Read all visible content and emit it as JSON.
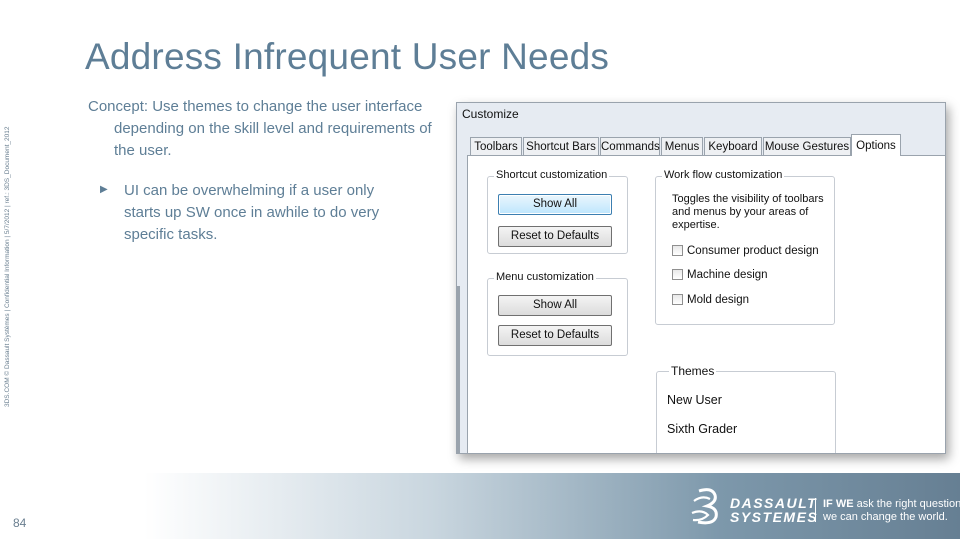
{
  "slide": {
    "title": "Address Infrequent User Needs",
    "side_text": "3DS.COM © Dassault Systèmes | Confidential Information | 5/7/2012 | ref.: 3DS_Document_2012",
    "page_number": "84",
    "concept_lines": [
      "Concept:  Use themes to change the user interface",
      "depending on the skill level and requirements of",
      "the user."
    ],
    "bullet_marker": "▶",
    "bullet_lines": [
      "UI can be overwhelming if a user only",
      "starts up SW once in awhile to do very",
      "specific tasks."
    ]
  },
  "dialog": {
    "title": "Customize",
    "tabs": [
      "Toolbars",
      "Shortcut Bars",
      "Commands",
      "Menus",
      "Keyboard",
      "Mouse Gestures",
      "Options"
    ],
    "active_tab": "Options",
    "shortcut_group": {
      "legend": "Shortcut customization",
      "show_all": "Show All",
      "reset": "Reset to Defaults"
    },
    "menu_group": {
      "legend": "Menu customization",
      "show_all": "Show All",
      "reset": "Reset to Defaults"
    },
    "workflow_group": {
      "legend": "Work flow customization",
      "description_lines": [
        "Toggles the visibility of toolbars",
        "and menus by your areas of",
        "expertise."
      ],
      "options": [
        {
          "label": "Consumer product design",
          "checked": false
        },
        {
          "label": "Machine design",
          "checked": false
        },
        {
          "label": "Mold design",
          "checked": false
        }
      ]
    },
    "themes_group": {
      "legend": "Themes",
      "items": [
        "New User",
        "Sixth Grader"
      ]
    }
  },
  "footer": {
    "brand_line1": "DASSAULT",
    "brand_line2": "SYSTEMES",
    "slogan_bold": "IF WE",
    "slogan_line1_rest": " ask the right questions",
    "slogan_line2": "we can change the world.",
    "colors": {
      "accent": "#5e7e96",
      "footer_dark": "#667f93"
    }
  }
}
